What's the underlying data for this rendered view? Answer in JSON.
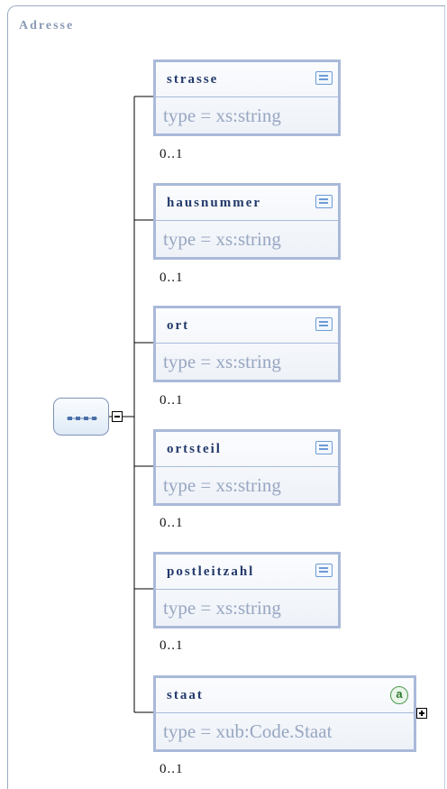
{
  "diagram": {
    "title": "Adresse",
    "sequence_icon": "sequence-compositor-icon",
    "elements": [
      {
        "name": "strasse",
        "type": "type = xs:string",
        "cardinality": "0..1",
        "icon": "documentation-icon"
      },
      {
        "name": "hausnummer",
        "type": "type = xs:string",
        "cardinality": "0..1",
        "icon": "documentation-icon"
      },
      {
        "name": "ort",
        "type": "type = xs:string",
        "cardinality": "0..1",
        "icon": "documentation-icon"
      },
      {
        "name": "ortsteil",
        "type": "type = xs:string",
        "cardinality": "0..1",
        "icon": "documentation-icon"
      },
      {
        "name": "postleitzahl",
        "type": "type = xs:string",
        "cardinality": "0..1",
        "icon": "documentation-icon"
      },
      {
        "name": "staat",
        "type": "type = xub:Code.Staat",
        "cardinality": "0..1",
        "icon": "attribute-icon",
        "icon_text": "a"
      }
    ]
  }
}
